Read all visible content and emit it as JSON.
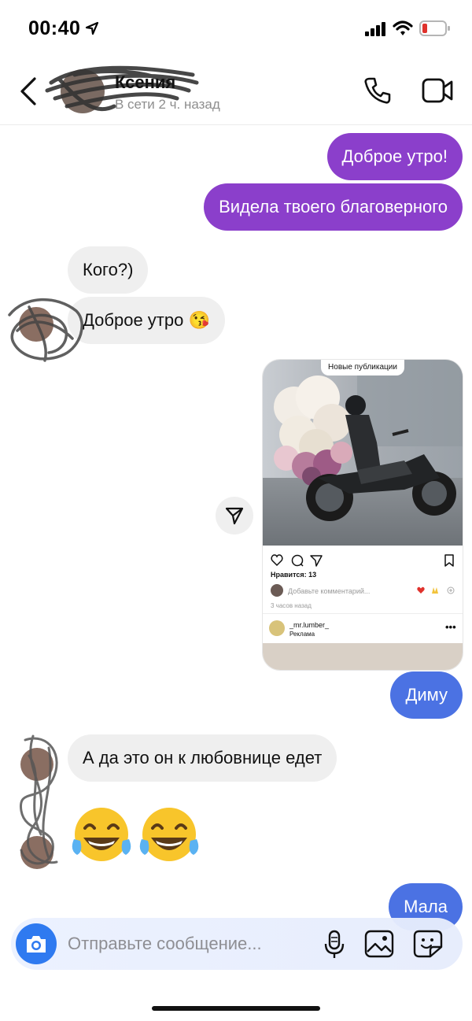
{
  "status_bar": {
    "time": "00:40",
    "icons": [
      "location-arrow-icon",
      "cellular-signal-icon",
      "wifi-icon",
      "battery-low-icon"
    ]
  },
  "header": {
    "contact_name": "Ксения",
    "presence": "В сети 2 ч. назад",
    "icons": [
      "back-chevron-icon",
      "phone-icon",
      "video-call-icon"
    ]
  },
  "messages": {
    "m1": "Доброе утро!",
    "m2": "Видела твоего благоверного",
    "m3": "Кого?)",
    "m4": "Доброе утро 😘",
    "m5": "Диму",
    "m6": "А да это он к любовнице едет",
    "m7": "😂😂",
    "m8": "Мала"
  },
  "shared_post": {
    "banner": "Новые публикации",
    "likes": "Нравится: 13",
    "comment_placeholder": "Добавьте комментарий...",
    "time_ago": "3 часов назад",
    "account": "_mr.lumber_",
    "sponsored": "Реклама",
    "more": "•••"
  },
  "composer": {
    "placeholder": "Отправьте сообщение...",
    "icons": [
      "camera-icon",
      "microphone-icon",
      "gallery-icon",
      "sticker-icon"
    ]
  },
  "colors": {
    "outgoing_purple": "#8b3fcb",
    "outgoing_blue": "#4b72e3",
    "incoming_gray": "#efefef",
    "camera_blue": "#2f7af0"
  }
}
